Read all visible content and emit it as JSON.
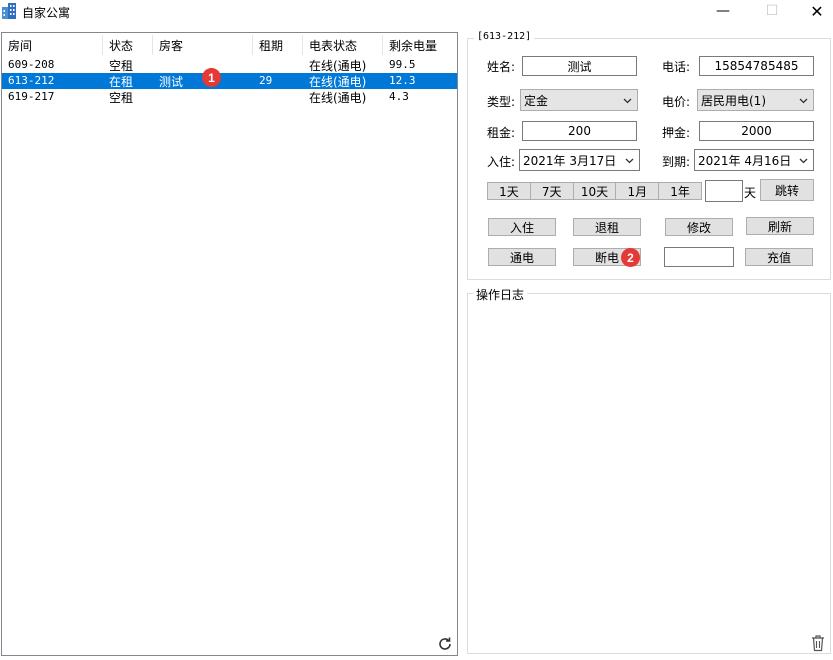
{
  "window": {
    "title": "自家公寓",
    "min_glyph": "—",
    "max_glyph": "☐",
    "close_glyph": "✕"
  },
  "room_list": {
    "columns": [
      "房间",
      "状态",
      "房客",
      "租期",
      "电表状态",
      "剩余电量"
    ],
    "rows": [
      {
        "room": "609-208",
        "status": "空租",
        "tenant": "",
        "term": "",
        "meter": "在线(通电)",
        "power": "99.5"
      },
      {
        "room": "613-212",
        "status": "在租",
        "tenant": "测试",
        "term": "29",
        "meter": "在线(通电)",
        "power": "12.3"
      },
      {
        "room": "619-217",
        "status": "空租",
        "tenant": "",
        "term": "",
        "meter": "在线(通电)",
        "power": "4.3"
      }
    ],
    "selected_index": 1
  },
  "badges": {
    "one": "1",
    "two": "2"
  },
  "room_detail": {
    "group_title": "[613-212]",
    "name_label": "姓名:",
    "name_value": "测试",
    "phone_label": "电话:",
    "phone_value": "15854785485",
    "type_label": "类型:",
    "type_value": "定金",
    "price_label": "电价:",
    "price_value": "居民用电(1)",
    "rent_label": "租金:",
    "rent_value": "200",
    "deposit_label": "押金:",
    "deposit_value": "2000",
    "checkin_label": "入住:",
    "checkin_value": "2021年  3月17日",
    "expire_label": "到期:",
    "expire_value": "2021年  4月16日",
    "durations": [
      "1天",
      "7天",
      "10天",
      "1月",
      "1年"
    ],
    "days_value": "",
    "days_unit": "天",
    "jump_label": "跳转",
    "checkin_btn": "入住",
    "checkout_btn": "退租",
    "modify_btn": "修改",
    "refresh_btn": "刷新",
    "power_on_btn": "通电",
    "power_off_btn": "断电",
    "recharge_value": "",
    "recharge_btn": "充值"
  },
  "log": {
    "title": "操作日志"
  },
  "colors": {
    "selection": "#0078d7",
    "badge": "#e53935"
  }
}
